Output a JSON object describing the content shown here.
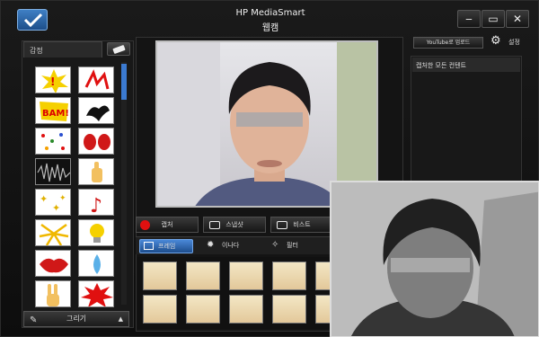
{
  "window": {
    "app_name": "HP MediaSmart",
    "subtitle": "웹캠",
    "minimize_icon": "minimize-icon",
    "maximize_icon": "maximize-icon",
    "close_icon": "close-icon"
  },
  "effects_panel": {
    "tab_label": "감정",
    "stickers": [
      "exclamation-sticker-icon",
      "red-squiggle-sticker-icon",
      "bam-sticker-icon",
      "black-bird-sticker-icon",
      "confetti-sticker-icon",
      "red-hands-sticker-icon",
      "sound-wave-sticker-icon",
      "thumbs-up-hand-sticker-icon",
      "yellow-stars-sticker-icon",
      "music-note-sticker-icon",
      "yellow-sparks-sticker-icon",
      "light-bulb-sticker-icon",
      "red-lips-sticker-icon",
      "water-drops-sticker-icon",
      "peace-hand-sticker-icon",
      "red-burst-sticker-icon"
    ],
    "draw_button_label": "그리기"
  },
  "center": {
    "capture_label": "캡처",
    "snapshot_label": "스냅샷",
    "video_label": "비스트"
  },
  "effect_tabs": [
    {
      "label": "프레임",
      "icon": "frame-icon",
      "active": true
    },
    {
      "label": "이나다",
      "icon": "sun-icon",
      "active": false
    },
    {
      "label": "필터",
      "icon": "wand-icon",
      "active": false
    }
  ],
  "right_panel": {
    "youtube_button": "YouTube로 업로드",
    "settings_label": "설정",
    "header": "캡처한 모든 컨텐트"
  },
  "colors": {
    "accent_blue": "#3b7ad0",
    "record_red": "#e01010",
    "background": "#0d0d0d"
  }
}
